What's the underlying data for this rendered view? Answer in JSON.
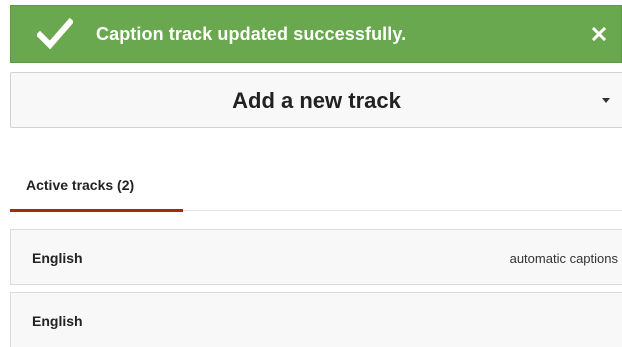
{
  "banner": {
    "message": "Caption track updated successfully.",
    "icon": "checkmark-icon",
    "close_icon": "close-icon",
    "color": "#6aa84f"
  },
  "add_track": {
    "label": "Add a new track",
    "icon": "caret-down-icon"
  },
  "tabs": {
    "active_label": "Active tracks (2)",
    "accent": "#a32d00"
  },
  "tracks": [
    {
      "language": "English",
      "type": "automatic captions"
    },
    {
      "language": "English",
      "type": ""
    }
  ]
}
